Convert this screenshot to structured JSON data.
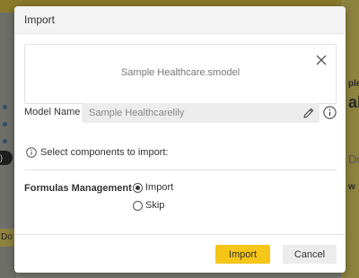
{
  "background": {
    "fragments": [
      "ple",
      "al",
      "Do",
      "w",
      "Do"
    ],
    "colors": {
      "overlay": "#7a7a74",
      "accent_bar": "#8f8340"
    }
  },
  "dialog": {
    "title": "Import",
    "file_name": "Sample Healthcare.smodel",
    "model_name": {
      "label": "Model Name",
      "value": "Sample Healthcarelily"
    },
    "select_components_text": "Select components to import:",
    "formulas": {
      "label": "Formulas Management",
      "options": [
        {
          "label": "Import",
          "selected": true
        },
        {
          "label": "Skip",
          "selected": false
        }
      ]
    },
    "buttons": {
      "import_label": "Import",
      "cancel_label": "Cancel"
    },
    "colors": {
      "primary_button": "#f5c518",
      "secondary_button": "#ececec"
    }
  }
}
